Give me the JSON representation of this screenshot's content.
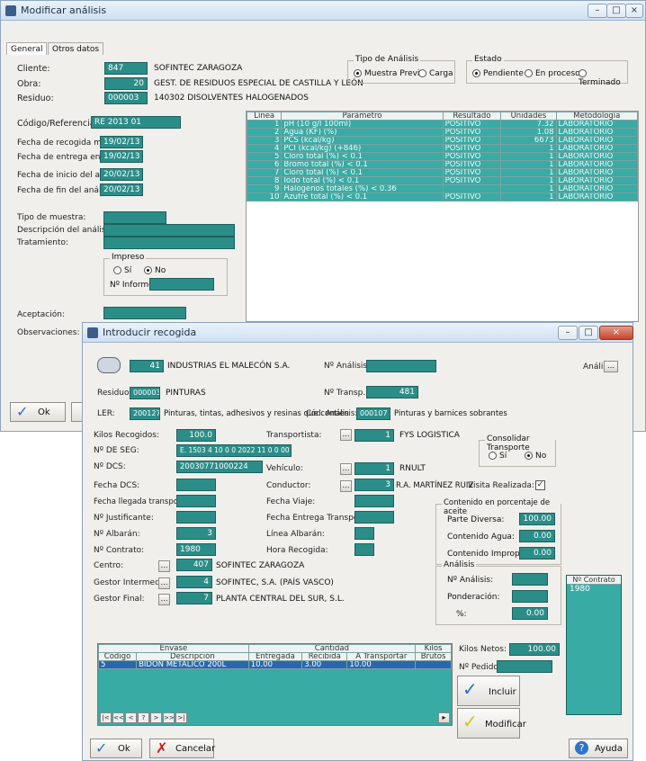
{
  "back": {
    "title": "Modificar análisis",
    "tabs": [
      "General",
      "Otros datos"
    ],
    "cliente_label": "Cliente:",
    "cliente_code": "847",
    "cliente_name": "SOFINTEC ZARAGOZA",
    "obra_label": "Obra:",
    "obra_code": "20",
    "obra_name": "GEST. DE RESIDUOS ESPECIAL DE CASTILLA Y LEÓN",
    "residuo_label": "Residuo:",
    "residuo_code": "000003",
    "residuo_name": "140302 DISOLVENTES HALOGENADOS",
    "tipo_title": "Tipo de Análisis",
    "tipo_opts": [
      "Muestra Previa",
      "Carga"
    ],
    "estado_title": "Estado",
    "estado_opts": [
      "Pendiente",
      "En proceso",
      "Terminado"
    ],
    "codigo_label": "Código/Referencia:",
    "codigo_val": "RE 2013 01",
    "fecha1_label": "Fecha de recogida muestra:",
    "fecha1": "19/02/13",
    "fecha2_label": "Fecha de entrega en labor:",
    "fecha2": "19/02/13",
    "fecha3_label": "Fecha de inicio del análisis:",
    "fecha3": "20/02/13",
    "fecha4_label": "Fecha de fin del análisis:",
    "fecha4": "20/02/13",
    "tipo_muestra_label": "Tipo de muestra:",
    "desc_label": "Descripción del análisis:",
    "tratamiento_label": "Tratamiento:",
    "impreso_title": "Impreso",
    "si": "Sí",
    "no": "No",
    "informe_label": "Nº Informe:",
    "aceptacion_label": "Aceptación:",
    "observ_label": "Observaciones:",
    "ok": "Ok",
    "table_headers": [
      "Línea",
      "Parámetro",
      "Resultado",
      "Unidades",
      "Metodología"
    ],
    "table_rows": [
      [
        "1",
        "pH (10 g/l 100ml)",
        "POSITIVO",
        "7.32",
        "LABORATORIO"
      ],
      [
        "2",
        "Agua (KF) (%)",
        "POSITIVO",
        "1.08",
        "LABORATORIO"
      ],
      [
        "3",
        "PCS (kcal/kg)",
        "POSITIVO",
        "6673",
        "LABORATORIO"
      ],
      [
        "4",
        "PCI (kcal/kg) (+846)",
        "POSITIVO",
        "1",
        "LABORATORIO"
      ],
      [
        "5",
        "Cloro total (%) < 0.1",
        "POSITIVO",
        "1",
        "LABORATORIO"
      ],
      [
        "6",
        "Bromo total (%) < 0.1",
        "POSITIVO",
        "1",
        "LABORATORIO"
      ],
      [
        "7",
        "Cloro total (%) < 0.1",
        "POSITIVO",
        "1",
        "LABORATORIO"
      ],
      [
        "8",
        "Iodo total (%) < 0.1",
        "POSITIVO",
        "1",
        "LABORATORIO"
      ],
      [
        "9",
        "Halógenos totales (%) < 0.36",
        "",
        "1",
        "LABORATORIO"
      ],
      [
        "10",
        "Azufre total (%) < 0.1",
        "POSITIVO",
        "1",
        "LABORATORIO"
      ]
    ]
  },
  "front": {
    "title": "Introducir recogida",
    "id_num": "41",
    "id_name": "INDUSTRIAS EL MALECÓN S.A.",
    "nanalisis_label": "Nº Análisis:",
    "analisis_btn_label": "Análisis:",
    "residuo_label": "Residuo:",
    "residuo_code": "000003",
    "residuo_name": "PINTURAS",
    "ntransp_label": "Nº Transp.:",
    "ntransp": "481",
    "ler_label": "LER:",
    "ler_code": "200127",
    "ler_desc": "Pinturas, tintas, adhesivos y resinas que contien",
    "ler_cod_label": "Cód. Análisis:",
    "ler_cod": "000107",
    "ler_desc2": "Pinturas y barnices sobrantes",
    "kilos_label": "Kilos Recogidos:",
    "kilos": "100.0",
    "transp_label": "Transportista:",
    "transp_code": "1",
    "transp_name": "FYS LOGISTICA",
    "nds_label": "Nº DE SEG:",
    "nds": "E. 1503 4 10 0 0 2022 11 0 0 00 4",
    "nds2_label": "Nº DCS:",
    "nds2": "20030771000224",
    "vehiculo_label": "Vehículo:",
    "vehiculo_code": "1",
    "vehiculo_name": "RNULT",
    "fecha_dcs_label": "Fecha DCS:",
    "conductor_label": "Conductor:",
    "conductor_code": "3",
    "conductor_name": "R.A. MARTÍNEZ RUIZ",
    "fecha_lleg_label": "Fecha llegada transporte:",
    "fecha_viaje_label": "Fecha Viaje:",
    "nj_label": "Nº Justificante:",
    "fecha_ent_label": "Fecha Entrega Transporte:",
    "nalb_label": "Nº Albarán:",
    "nalb": "3",
    "linea_label": "Línea Albarán:",
    "ncontrato_label": "Nº Contrato:",
    "ncontrato": "1980",
    "hora_label": "Hora Recogida:",
    "centro_label": "Centro:",
    "centro_code": "407",
    "centro_name": "SOFINTEC ZARAGOZA",
    "gi_label": "Gestor Intermedio:",
    "gi_code": "4",
    "gi_name": "SOFINTEC, S.A. (PAÍS VASCO)",
    "gf_label": "Gestor Final:",
    "gf_code": "7",
    "gf_name": "PLANTA CENTRAL DEL SUR, S.L.",
    "consolidar_title": "Consolidar Transporte",
    "consolidar_si": "Sí",
    "consolidar_no": "No",
    "visita_label": "Visita Realizada:",
    "visita_check": "✓",
    "contenido_title": "Contenido en porcentaje de aceite",
    "parte_label": "Parte Diversa:",
    "parte": "100.00",
    "agua_label": "Contenido Agua:",
    "agua": "0.00",
    "impropio_label": "Contenido Impropio:",
    "impropio": "0.00",
    "analisis_title": "Análisis",
    "nan_label": "Nº Análisis:",
    "ponder_label": "Ponderación:",
    "pct_label": "%:",
    "pct": "0.00",
    "ncontratos_header": "Nº Contrato",
    "ncontratos_val": "1980",
    "table_group1": "Envase",
    "table_group2": "Cantidad",
    "table_group3": "Kilos",
    "table_headers": [
      "Código",
      "Descripción",
      "Entregada",
      "Recibida",
      "A Transportar",
      "Brutos"
    ],
    "table_row": [
      "5",
      "BIDÓN METÁLICO 200L",
      "10.00",
      "3.00",
      "10.00"
    ],
    "kilos_netos_label": "Kilos Netos:",
    "kilos_netos": "100.00",
    "npedido_label": "Nº Pedido:",
    "incluir": "Incluir",
    "modificar": "Modificar",
    "nav": [
      "|<",
      "<<",
      "<",
      "?",
      ">",
      ">>",
      ">|"
    ],
    "ok": "Ok",
    "cancel": "Cancelar",
    "help": "Ayuda"
  }
}
